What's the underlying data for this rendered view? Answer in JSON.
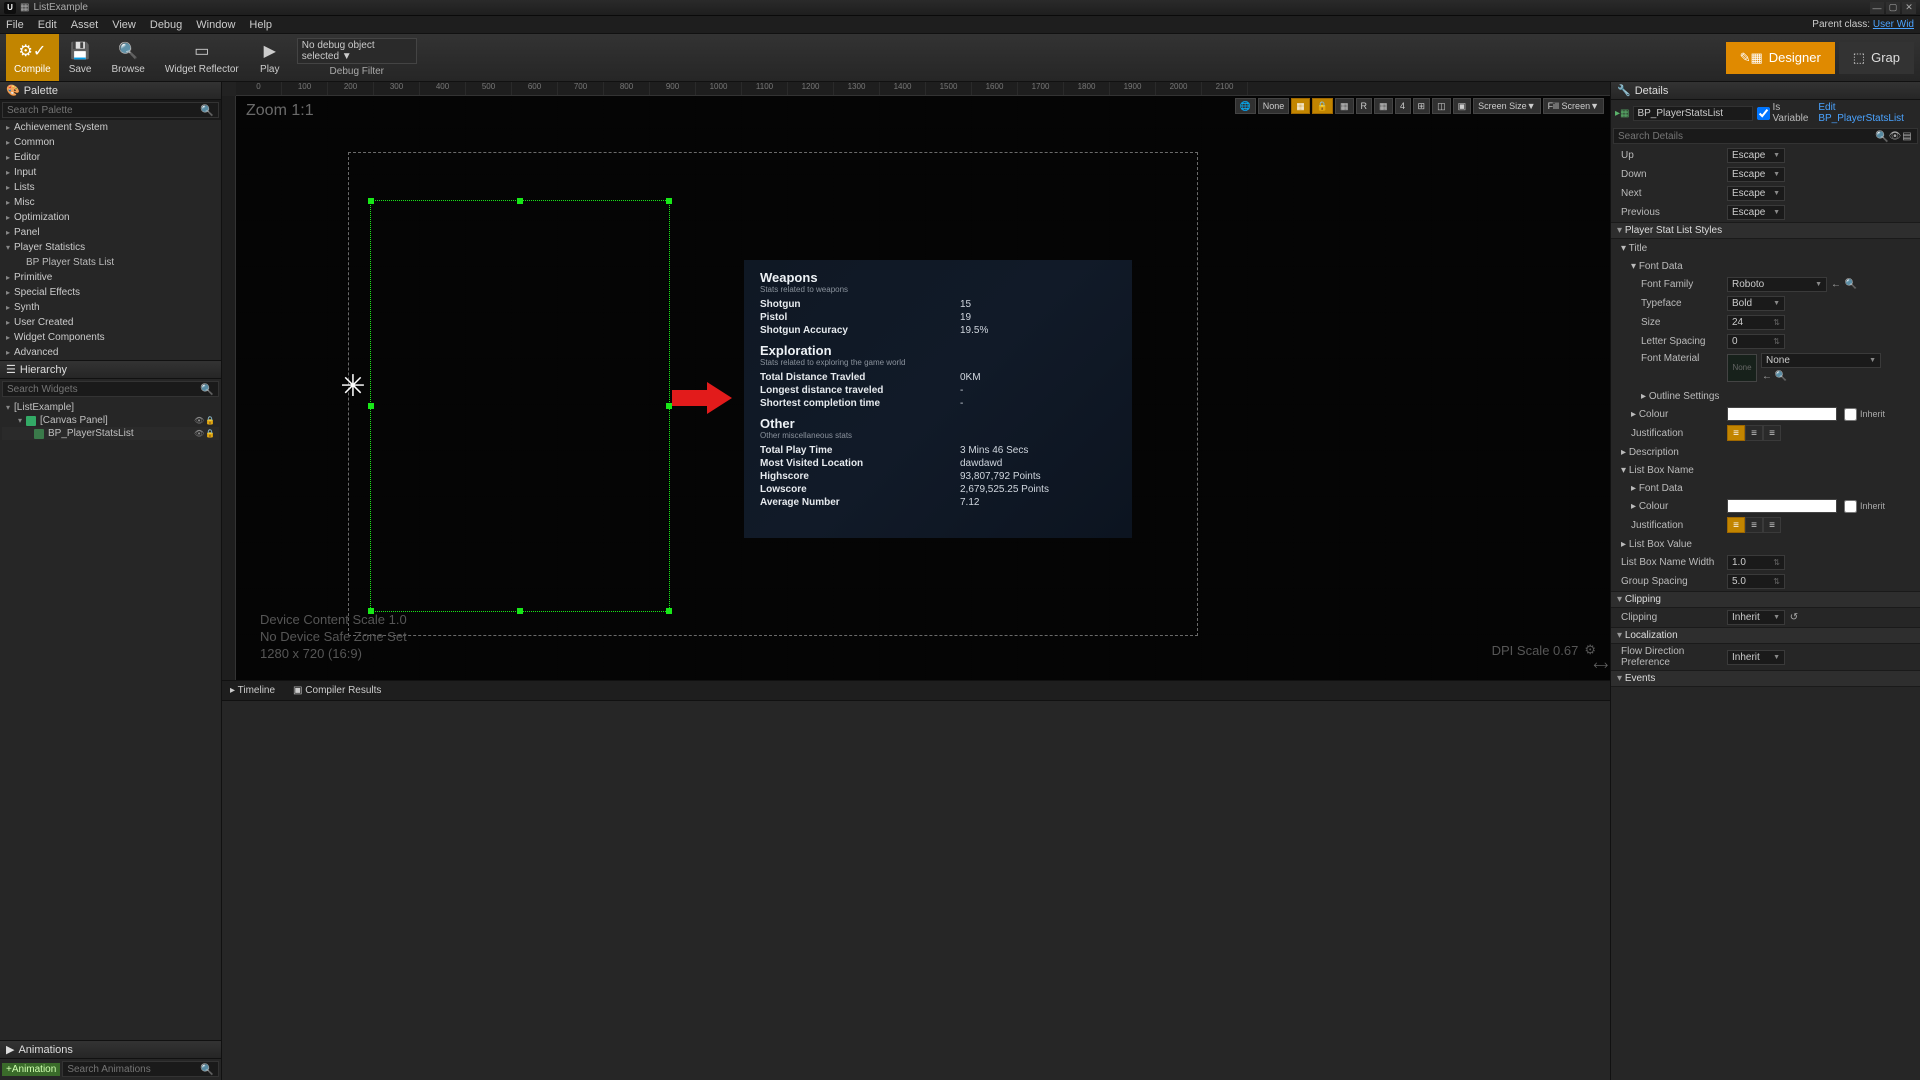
{
  "titlebar": {
    "doc": "ListExample"
  },
  "menubar": {
    "items": [
      "File",
      "Edit",
      "Asset",
      "View",
      "Debug",
      "Window",
      "Help"
    ],
    "parent_label": "Parent class:",
    "parent_link": "User Wid"
  },
  "toolbar": {
    "compile": "Compile",
    "save": "Save",
    "browse": "Browse",
    "reflector": "Widget Reflector",
    "play": "Play",
    "debug_select": "No debug object selected",
    "debug_filter": "Debug Filter",
    "designer": "Designer",
    "graph": "Grap"
  },
  "palette": {
    "title": "Palette",
    "search_ph": "Search Palette",
    "cats": [
      "Achievement System",
      "Common",
      "Editor",
      "Input",
      "Lists",
      "Misc",
      "Optimization",
      "Panel"
    ],
    "open_cat": "Player Statistics",
    "open_item": "BP Player Stats List",
    "cats2": [
      "Primitive",
      "Special Effects",
      "Synth",
      "User Created",
      "Widget Components",
      "Advanced"
    ]
  },
  "hierarchy": {
    "title": "Hierarchy",
    "search_ph": "Search Widgets",
    "root": "[ListExample]",
    "canvas": "[Canvas Panel]",
    "child": "BP_PlayerStatsList"
  },
  "animations": {
    "title": "Animations",
    "add": "+Animation",
    "search_ph": "Search Animations"
  },
  "viewport": {
    "zoom": "Zoom 1:1",
    "ruler": [
      "0",
      "100",
      "200",
      "300",
      "400",
      "500",
      "600",
      "700",
      "800",
      "900",
      "1000",
      "1100",
      "1200",
      "1300",
      "1400",
      "1500",
      "1600",
      "1700",
      "1800",
      "1900",
      "2000",
      "2100"
    ],
    "none_btn": "None",
    "grid_num": "4",
    "r_btn": "R",
    "screen_size": "Screen Size",
    "fill_screen": "Fill Screen",
    "footer": {
      "l1": "Device Content Scale 1.0",
      "l2": "No Device Safe Zone Set",
      "l3": "1280 x 720 (16:9)",
      "dpi": "DPI Scale 0.67"
    }
  },
  "stats": {
    "groups": [
      {
        "title": "Weapons",
        "sub": "Stats related to weapons",
        "rows": [
          {
            "n": "Shotgun",
            "v": "15"
          },
          {
            "n": "Pistol",
            "v": "19"
          },
          {
            "n": "Shotgun Accuracy",
            "v": "19.5%"
          }
        ]
      },
      {
        "title": "Exploration",
        "sub": "Stats related to exploring the game world",
        "rows": [
          {
            "n": "Total Distance Travled",
            "v": "0KM"
          },
          {
            "n": "Longest distance traveled",
            "v": "-"
          },
          {
            "n": "Shortest completion time",
            "v": "-"
          }
        ]
      },
      {
        "title": "Other",
        "sub": "Other miscellaneous stats",
        "rows": [
          {
            "n": "Total Play Time",
            "v": "3 Mins 46 Secs"
          },
          {
            "n": "Most Visited Location",
            "v": "dawdawd"
          },
          {
            "n": "Highscore",
            "v": "93,807,792 Points"
          },
          {
            "n": "Lowscore",
            "v": "2,679,525.25 Points"
          },
          {
            "n": "Average Number",
            "v": "7.12"
          }
        ]
      }
    ]
  },
  "bottom": {
    "timeline": "Timeline",
    "compiler": "Compiler Results"
  },
  "details": {
    "title": "Details",
    "bp_name": "BP_PlayerStatsList",
    "is_var": "Is Variable",
    "edit_link": "Edit BP_PlayerStatsList",
    "search_ph": "Search Details",
    "nav": {
      "up": "Up",
      "down": "Down",
      "next": "Next",
      "prev": "Previous",
      "val": "Escape"
    },
    "cat_styles": "Player Stat List Styles",
    "title_lbl": "Title",
    "font_data": "Font Data",
    "font_family": "Font Family",
    "font_family_v": "Roboto",
    "typeface": "Typeface",
    "typeface_v": "Bold",
    "size": "Size",
    "size_v": "24",
    "letter_spacing": "Letter Spacing",
    "letter_spacing_v": "0",
    "font_material": "Font Material",
    "font_material_v": "None",
    "font_material_thumb": "None",
    "outline": "Outline Settings",
    "colour": "Colour",
    "inherit": "Inherit",
    "justification": "Justification",
    "description": "Description",
    "listbox_name": "List Box Name",
    "listbox_value": "List Box Value",
    "listbox_name_width": "List Box Name Width",
    "listbox_name_width_v": "1.0",
    "group_spacing": "Group Spacing",
    "group_spacing_v": "5.0",
    "clipping": "Clipping",
    "clipping_v": "Inherit",
    "localization": "Localization",
    "flow_dir": "Flow Direction Preference",
    "flow_dir_v": "Inherit",
    "events": "Events"
  }
}
